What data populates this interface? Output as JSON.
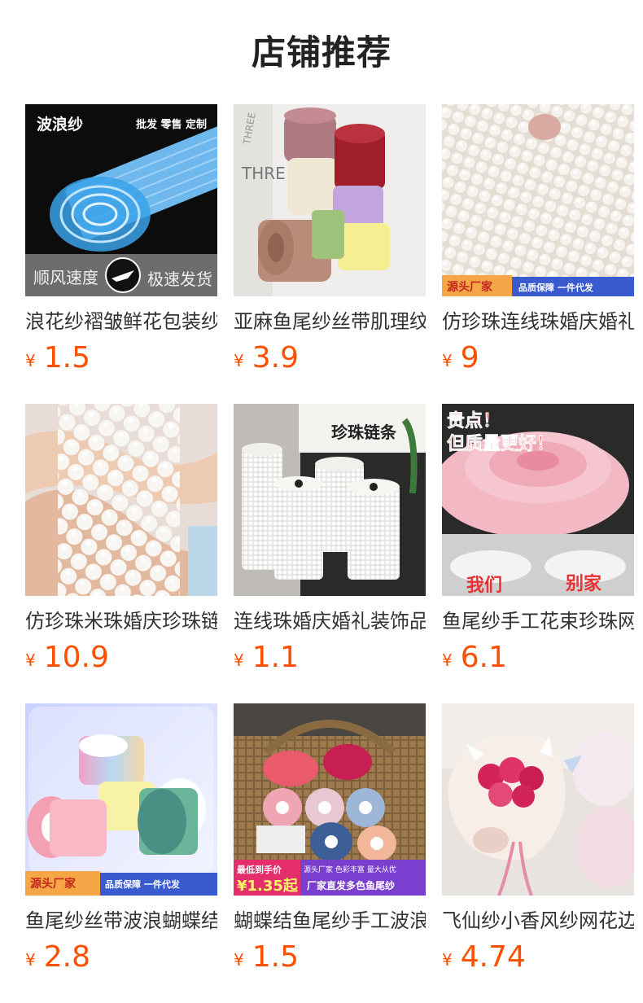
{
  "section": {
    "title": "店铺推荐"
  },
  "products": [
    {
      "name": "浪花纱褶皱鲜花包装纱",
      "currency": "¥",
      "price": "1.5",
      "image_text": [
        "波浪纱",
        "批发 零售 定制",
        "顺风速度",
        "极速发货"
      ]
    },
    {
      "name": "亚麻鱼尾纱丝带肌理纹",
      "currency": "¥",
      "price": "3.9",
      "image_text": [
        "THREE",
        "THRE"
      ]
    },
    {
      "name": "仿珍珠连线珠婚庆婚礼",
      "currency": "¥",
      "price": "9",
      "image_text": [
        "源头厂家",
        "品质保障 一件代发"
      ]
    },
    {
      "name": "仿珍珠米珠婚庆珍珠链",
      "currency": "¥",
      "price": "10.9",
      "image_text": []
    },
    {
      "name": "连线珠婚庆婚礼装饰品",
      "currency": "¥",
      "price": "1.1",
      "image_text": [
        "珍珠链条"
      ]
    },
    {
      "name": "鱼尾纱手工花束珍珠网",
      "currency": "¥",
      "price": "6.1",
      "image_text": [
        "贵点！",
        "但质量更好！",
        "我们",
        "别家"
      ]
    },
    {
      "name": "鱼尾纱丝带波浪蝴蝶结",
      "currency": "¥",
      "price": "2.8",
      "image_text": [
        "源头厂家",
        "品质保障 一件代发"
      ]
    },
    {
      "name": "蝴蝶结鱼尾纱手工波浪",
      "currency": "¥",
      "price": "1.5",
      "image_text": [
        "最低到手价",
        "¥1.35起",
        "源头厂家 色彩丰富 量大从优",
        "厂家直发多色鱼尾纱"
      ]
    },
    {
      "name": "飞仙纱小香风纱网花边",
      "currency": "¥",
      "price": "4.74",
      "image_text": []
    }
  ]
}
